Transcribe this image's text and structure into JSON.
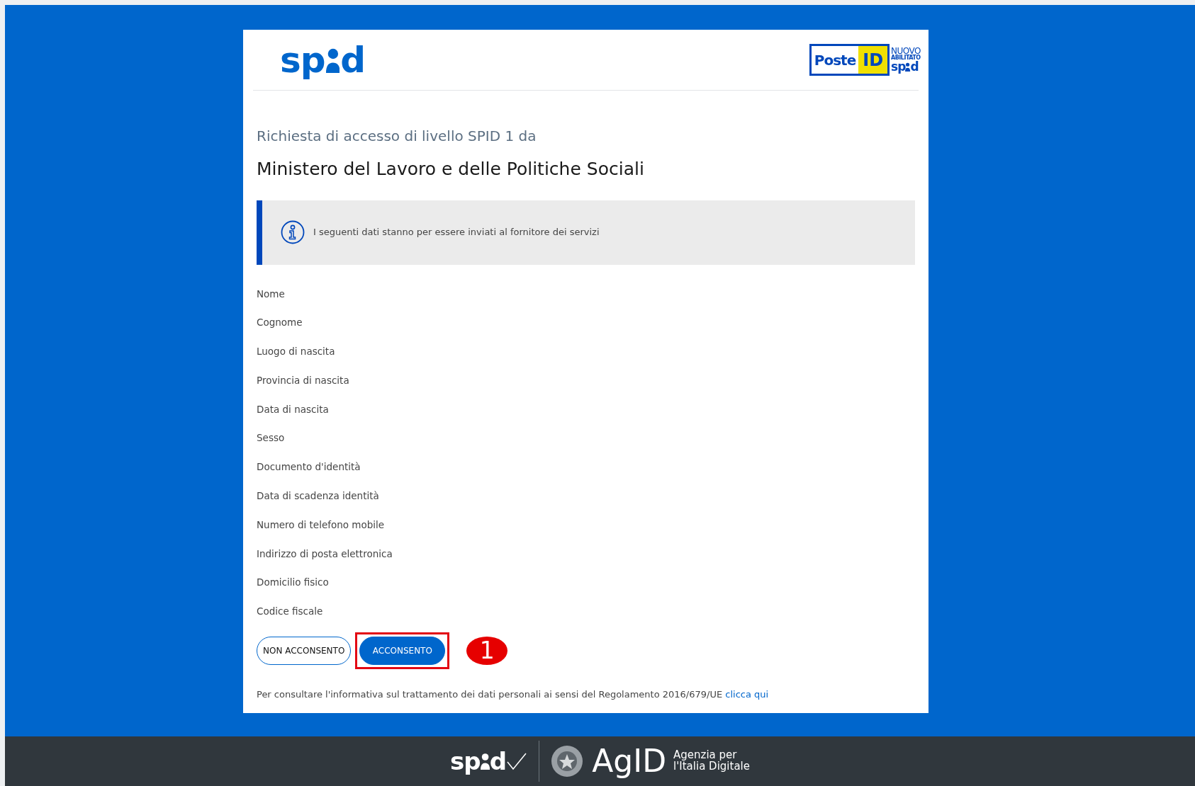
{
  "header": {
    "spid_logo": {
      "before": "sp",
      "after": "d"
    },
    "poste_logo": {
      "poste": "Poste",
      "id": "ID",
      "nuovo": "NUOVO",
      "abilitato": "ABILITATO",
      "spid_before": "sp",
      "spid_after": "d"
    }
  },
  "subtitle": "Richiesta di accesso di livello SPID 1 da",
  "title": "Ministero del Lavoro e delle Politiche Sociali",
  "notice": "I seguenti dati stanno per essere inviati al fornitore dei servizi",
  "attributes": [
    "Nome",
    "Cognome",
    "Luogo di nascita",
    "Provincia di nascita",
    "Data di nascita",
    "Sesso",
    "Documento d'identità",
    "Data di scadenza identità",
    "Numero di telefono mobile",
    "Indirizzo di posta elettronica",
    "Domicilio fisico",
    "Codice fiscale"
  ],
  "buttons": [
    {
      "label": "NON ACCONSENTO",
      "kind": "outline",
      "highlighted": false
    },
    {
      "label": "ACCONSENTO",
      "kind": "primary",
      "highlighted": true
    }
  ],
  "annotation": "1",
  "privacy": {
    "text": "Per consultare l'informativa sul trattamento dei dati personali ai sensi del Regolamento 2016/679/UE",
    "link": "clicca qui"
  },
  "footer": {
    "spid_before": "sp",
    "spid_after": "d",
    "agid": "AgID",
    "agency_line1": "Agenzia per",
    "agency_line2": "l'Italia Digitale"
  }
}
